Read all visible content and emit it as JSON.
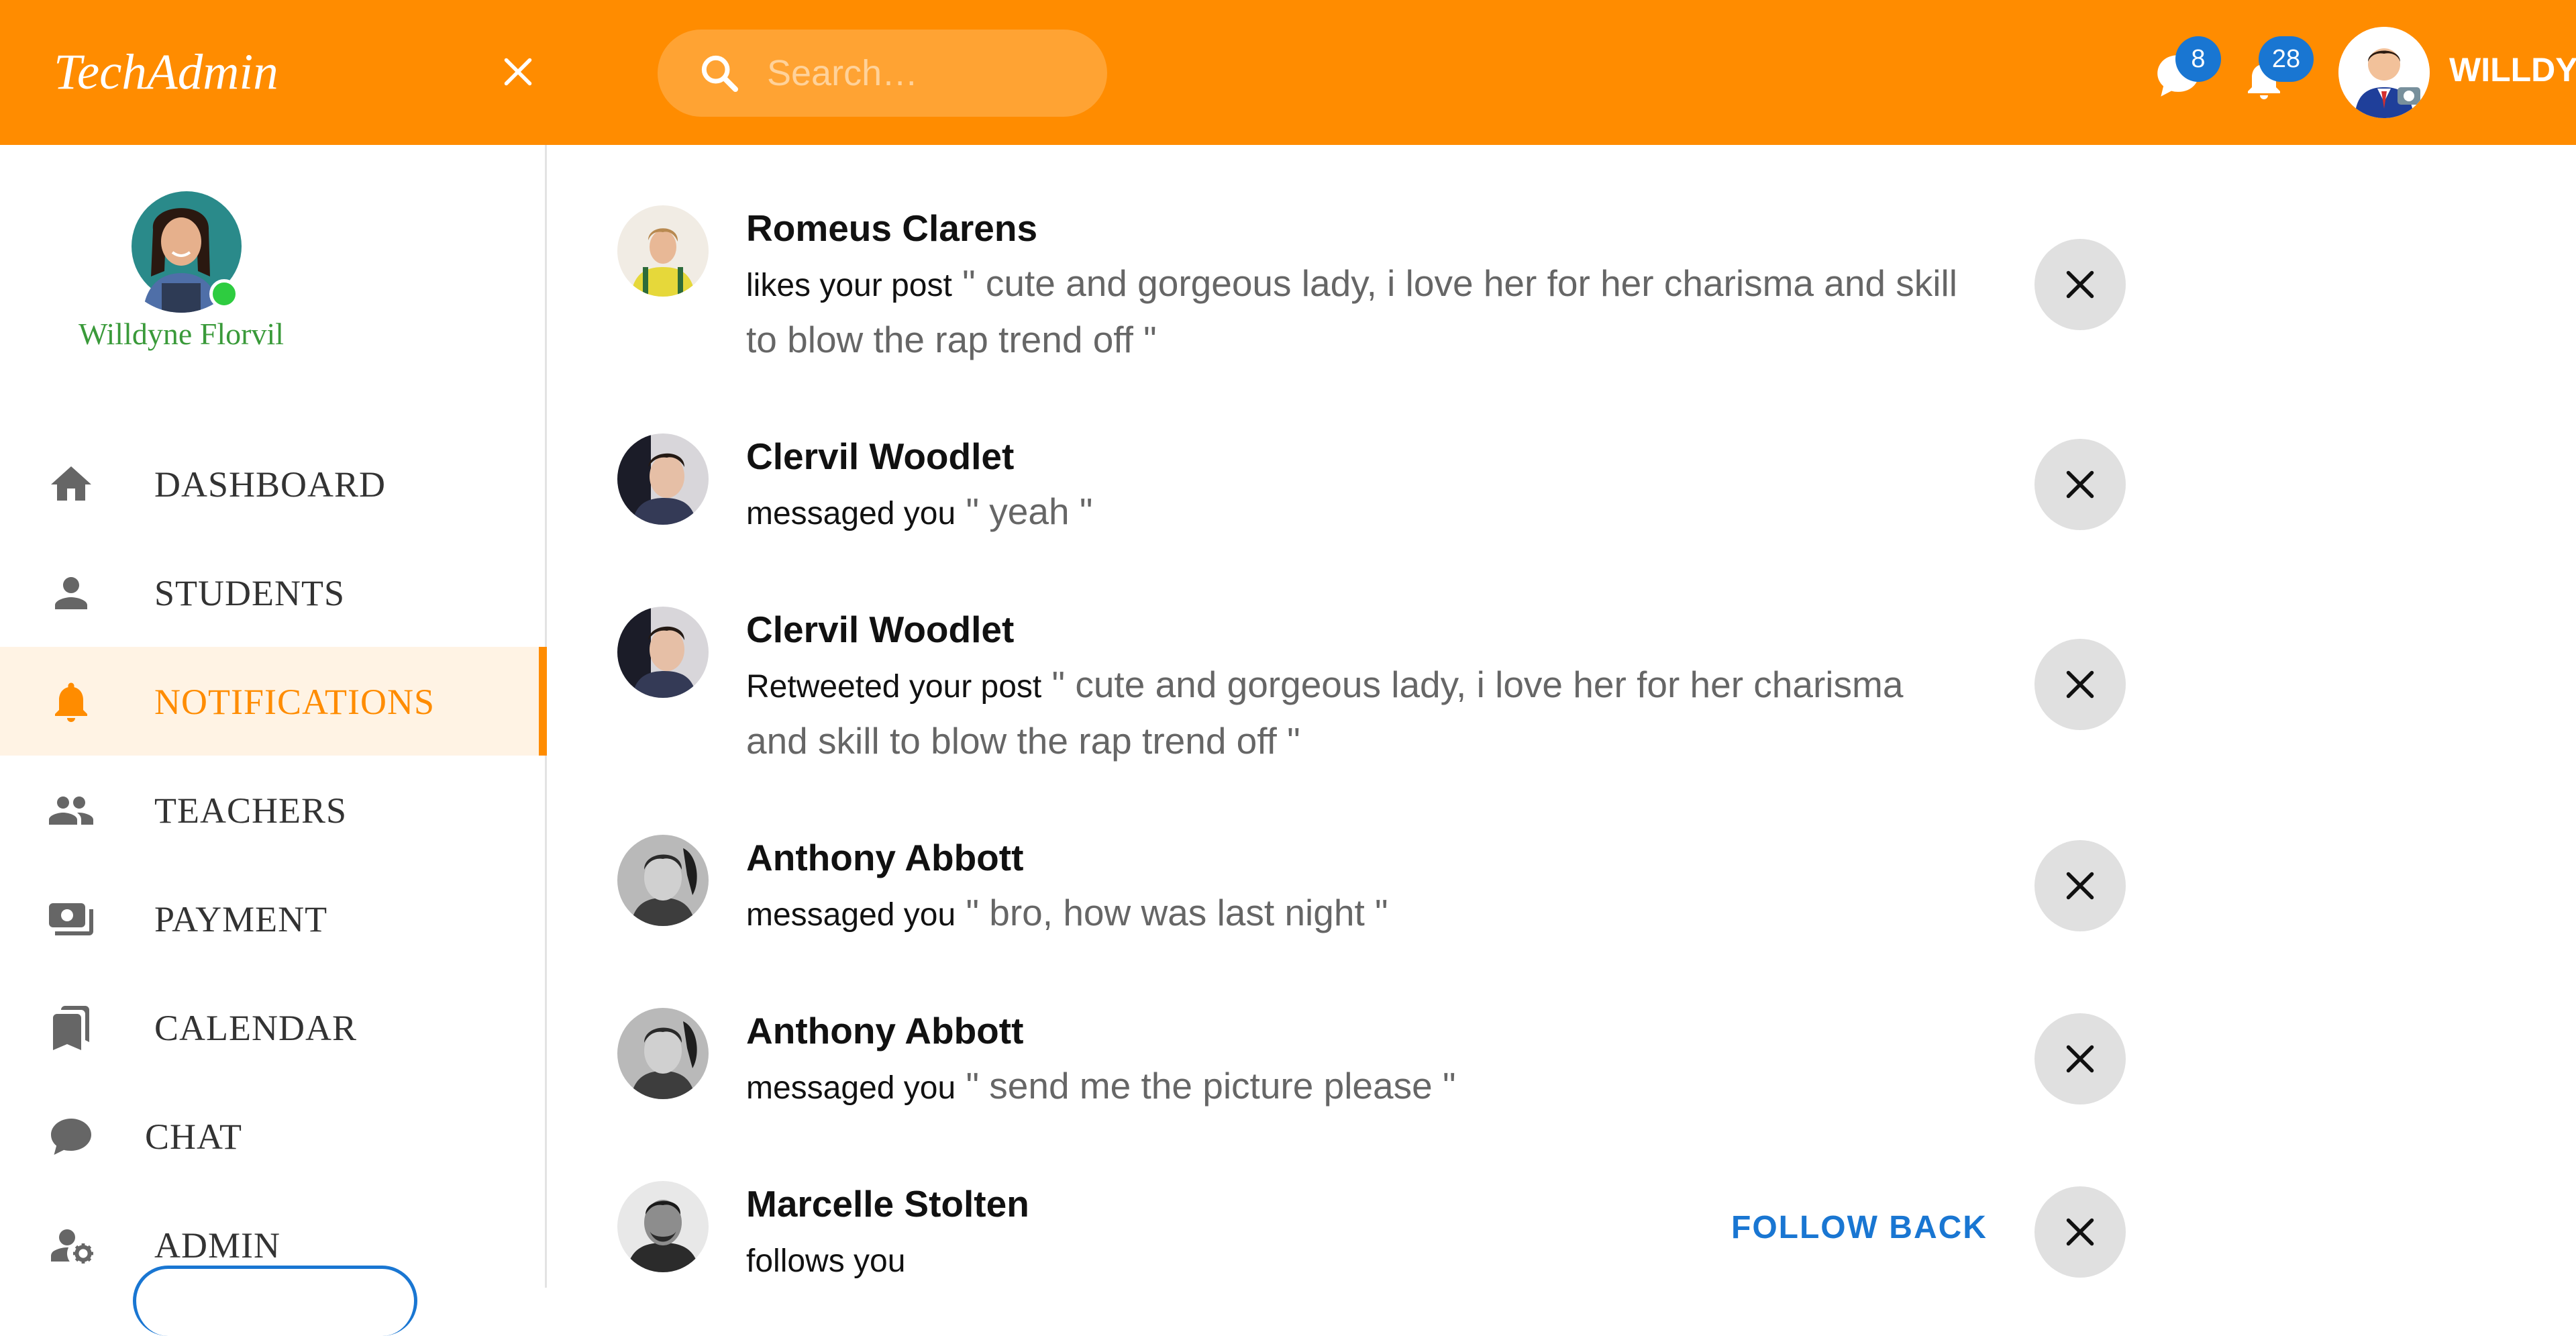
{
  "app": {
    "brand": "TechAdmin"
  },
  "topbar": {
    "search_placeholder": "Search…",
    "messages_count": "8",
    "notifications_count": "28",
    "user_name": "WILLDY"
  },
  "sidebar": {
    "profile_name": "Willdyne Florvil",
    "items": [
      {
        "label": "DASHBOARD",
        "icon": "home-icon"
      },
      {
        "label": "STUDENTS",
        "icon": "person-icon"
      },
      {
        "label": "NOTIFICATIONS",
        "icon": "bell-icon",
        "active": true
      },
      {
        "label": "TEACHERS",
        "icon": "group-icon"
      },
      {
        "label": "PAYMENT",
        "icon": "payments-icon"
      },
      {
        "label": "CALENDAR",
        "icon": "bookmarks-icon"
      },
      {
        "label": "CHAT",
        "icon": "chat-bubble-icon"
      },
      {
        "label": "ADMIN",
        "icon": "admin-settings-icon"
      }
    ]
  },
  "notifications": [
    {
      "name": "Romeus Clarens",
      "action": "likes your post",
      "content": "\" cute and gorgeous lady, i love her for her charisma and skill to blow the rap trend off \""
    },
    {
      "name": "Clervil Woodlet",
      "action": "messaged you",
      "content": "\" yeah \""
    },
    {
      "name": "Clervil Woodlet",
      "action": "Retweeted your post",
      "content": "\" cute and gorgeous lady, i love her for her charisma and skill to blow the rap trend off \""
    },
    {
      "name": "Anthony Abbott",
      "action": "messaged you",
      "content": "\" bro, how was last night \""
    },
    {
      "name": "Anthony Abbott",
      "action": "messaged you",
      "content": "\" send me the picture please \""
    },
    {
      "name": "Marcelle Stolten",
      "action": "follows you",
      "content": "",
      "button": "FOLLOW BACK"
    }
  ],
  "colors": {
    "accent": "#ff8c00",
    "badge": "#1976d2",
    "link": "#1976d2"
  }
}
